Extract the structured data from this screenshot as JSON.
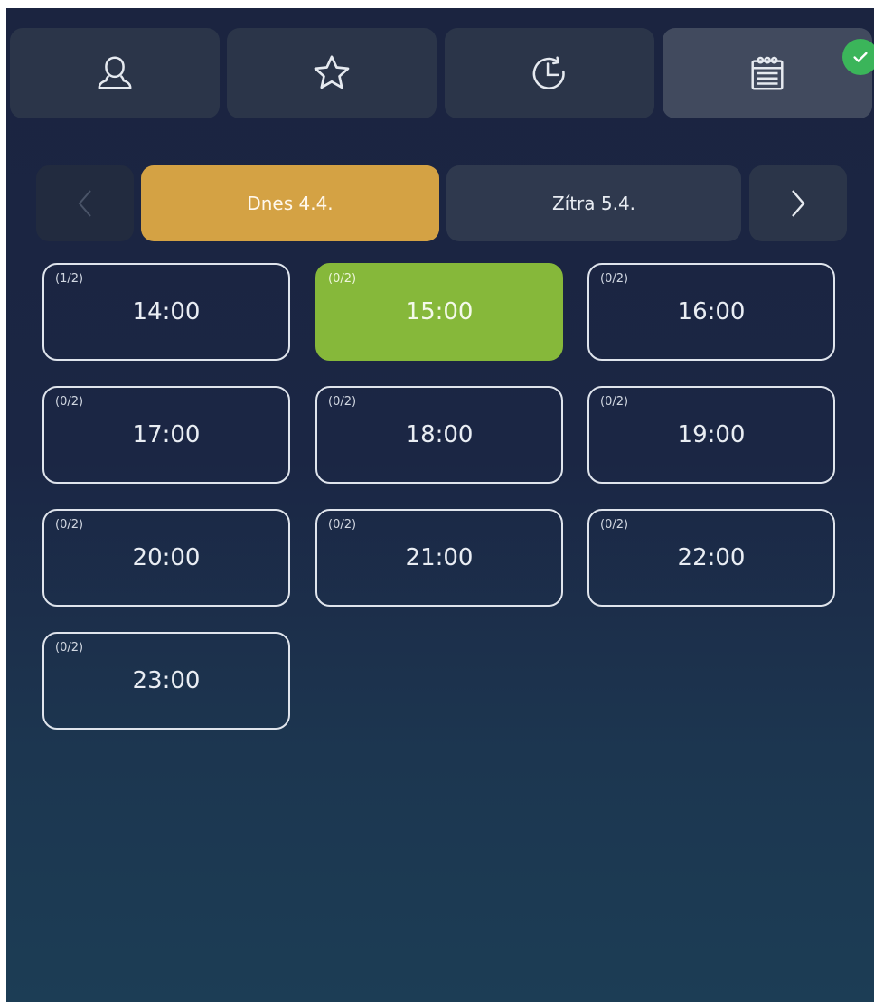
{
  "nav": {
    "tabs": [
      {
        "name": "profile",
        "icon": "user-icon",
        "active": false
      },
      {
        "name": "favorites",
        "icon": "star-icon",
        "active": false
      },
      {
        "name": "history",
        "icon": "clock-history-icon",
        "active": false
      },
      {
        "name": "schedule",
        "icon": "calendar-icon",
        "active": true
      }
    ],
    "badge_icon": "check-icon"
  },
  "days": {
    "today_label": "Dnes 4.4.",
    "tomorrow_label": "Zítra 5.4.",
    "prev_icon": "chevron-left-icon",
    "next_icon": "chevron-right-icon"
  },
  "slots": [
    {
      "cap": "(1/2)",
      "time": "14:00",
      "selected": false
    },
    {
      "cap": "(0/2)",
      "time": "15:00",
      "selected": true
    },
    {
      "cap": "(0/2)",
      "time": "16:00",
      "selected": false
    },
    {
      "cap": "(0/2)",
      "time": "17:00",
      "selected": false
    },
    {
      "cap": "(0/2)",
      "time": "18:00",
      "selected": false
    },
    {
      "cap": "(0/2)",
      "time": "19:00",
      "selected": false
    },
    {
      "cap": "(0/2)",
      "time": "20:00",
      "selected": false
    },
    {
      "cap": "(0/2)",
      "time": "21:00",
      "selected": false
    },
    {
      "cap": "(0/2)",
      "time": "22:00",
      "selected": false
    },
    {
      "cap": "(0/2)",
      "time": "23:00",
      "selected": false
    }
  ],
  "colors": {
    "today": "#d4a244",
    "selected_slot": "#86b83a",
    "badge": "#3bb55a"
  }
}
